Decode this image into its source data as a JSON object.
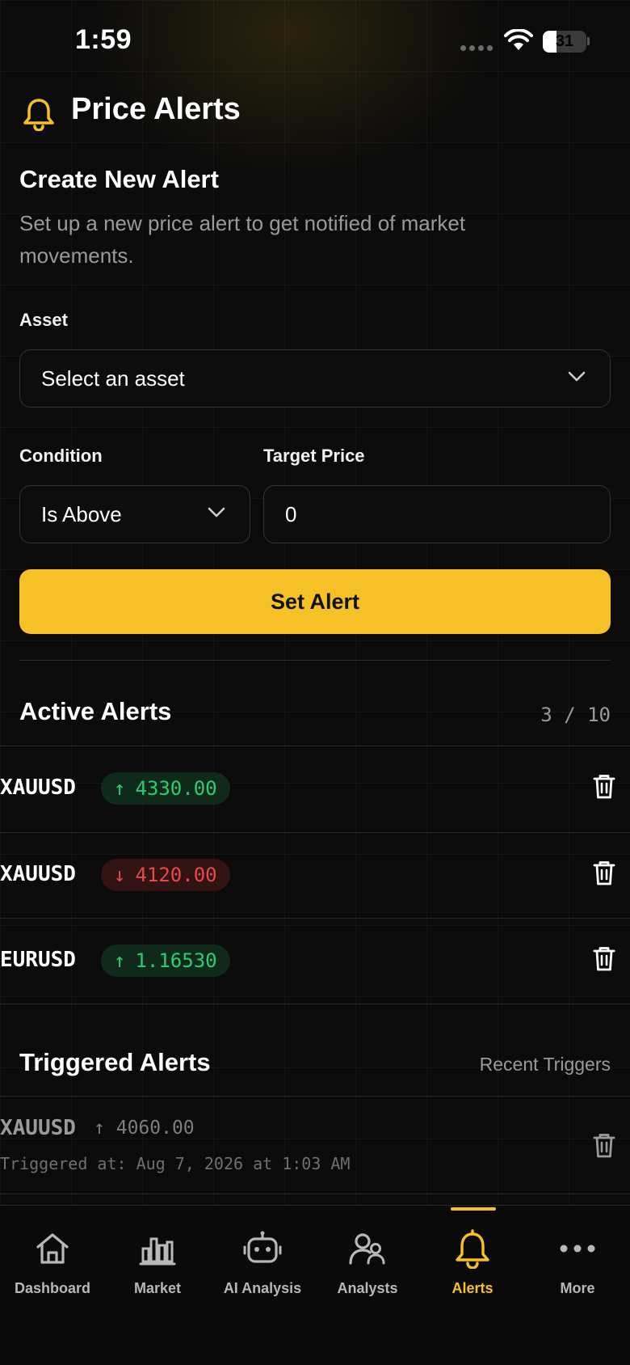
{
  "status_bar": {
    "time": "1:59",
    "battery": "31"
  },
  "header": {
    "title": "Price Alerts",
    "icon": "bell-icon"
  },
  "create": {
    "title": "Create New Alert",
    "description": "Set up a new price alert to get notified of market movements.",
    "asset_label": "Asset",
    "asset_placeholder": "Select an asset",
    "condition_label": "Condition",
    "condition_value": "Is Above",
    "target_label": "Target Price",
    "target_value": "0",
    "submit_label": "Set Alert"
  },
  "active": {
    "title": "Active Alerts",
    "count": "3 / 10",
    "items": [
      {
        "symbol": "XAUUSD",
        "direction": "up",
        "arrow": "↑",
        "price": "4330.00"
      },
      {
        "symbol": "XAUUSD",
        "direction": "down",
        "arrow": "↓",
        "price": "4120.00"
      },
      {
        "symbol": "EURUSD",
        "direction": "up",
        "arrow": "↑",
        "price": "1.16530"
      }
    ]
  },
  "triggered": {
    "title": "Triggered Alerts",
    "subtitle": "Recent Triggers",
    "items": [
      {
        "symbol": "XAUUSD",
        "arrow": "↑",
        "price": "4060.00",
        "time": "Triggered at: Aug 7, 2026 at 1:03 AM"
      }
    ]
  },
  "tabs": [
    {
      "label": "Dashboard",
      "icon": "home-icon"
    },
    {
      "label": "Market",
      "icon": "bar-chart-icon"
    },
    {
      "label": "AI Analysis",
      "icon": "robot-icon"
    },
    {
      "label": "Analysts",
      "icon": "users-icon"
    },
    {
      "label": "Alerts",
      "icon": "bell-icon",
      "active": true
    },
    {
      "label": "More",
      "icon": "more-icon"
    }
  ],
  "colors": {
    "accent": "#f6c126",
    "up": "#2ecc71",
    "down": "#e74848",
    "background": "#0b0b0b"
  }
}
